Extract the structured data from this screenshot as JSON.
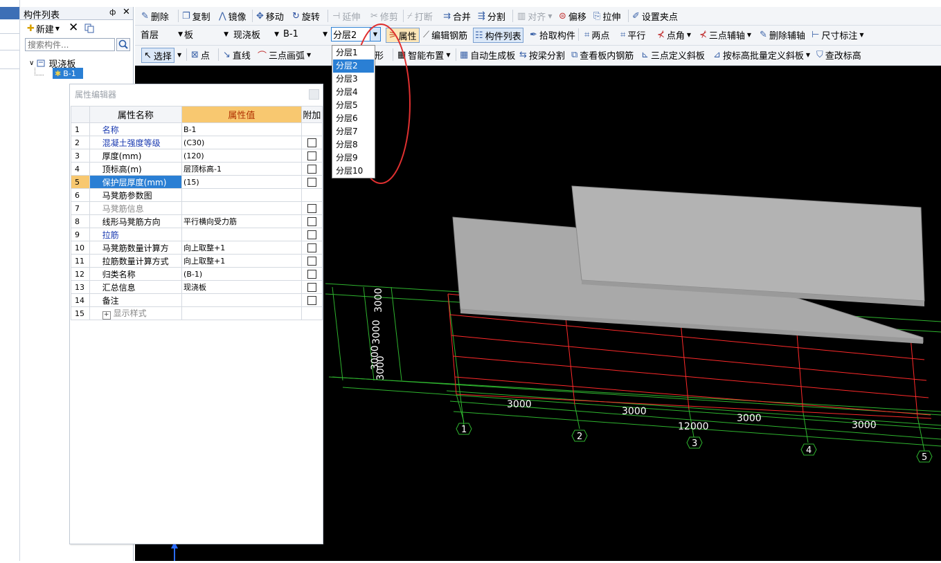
{
  "component_panel": {
    "title": "构件列表",
    "pin_label": "ф",
    "close_label": "✕",
    "new_label": "新建",
    "search_placeholder": "搜索构件...",
    "tree": {
      "root_label": "现浇板",
      "child_label": "B-1"
    }
  },
  "toolbar1": {
    "delete": "删除",
    "copy": "复制",
    "mirror": "镜像",
    "move": "移动",
    "rotate": "旋转",
    "extend": "延伸",
    "trim": "修剪",
    "break": "打断",
    "merge": "合并",
    "split": "分割",
    "align": "对齐",
    "offset": "偏移",
    "stretch": "拉伸",
    "set_grip": "设置夹点"
  },
  "toolbar2": {
    "floor": "首层",
    "category": "板",
    "type": "现浇板",
    "component": "B-1",
    "sublayer": "分层2",
    "properties": "属性",
    "edit_rebar": "编辑钢筋",
    "component_list": "构件列表",
    "pick_component": "拾取构件",
    "two_points": "两点",
    "parallel": "平行",
    "point_angle": "点角",
    "three_point_axis": "三点辅轴",
    "delete_axis": "删除辅轴",
    "dimension": "尺寸标注"
  },
  "toolbar3": {
    "select": "选择",
    "point": "点",
    "line": "直线",
    "three_point_arc": "三点画弧",
    "rect_partial": "矩形",
    "smart_place": "智能布置",
    "auto_slab": "自动生成板",
    "split_by_beam": "按梁分割",
    "view_rebar": "查看板内钢筋",
    "three_point_slope": "三点定义斜板",
    "batch_slope": "按标高批量定义斜板",
    "edit_elevation": "查改标高"
  },
  "sublayer_dropdown": {
    "options": [
      "分层1",
      "分层2",
      "分层3",
      "分层4",
      "分层5",
      "分层6",
      "分层7",
      "分层8",
      "分层9",
      "分层10"
    ],
    "selected_index": 1
  },
  "property_editor": {
    "title": "属性编辑器",
    "headers": {
      "name": "属性名称",
      "value": "属性值",
      "extra": "附加"
    },
    "rows": [
      {
        "num": "1",
        "name": "名称",
        "value": "B-1",
        "style": "blue",
        "check": false
      },
      {
        "num": "2",
        "name": "混凝土强度等级",
        "value": "(C30)",
        "style": "blue",
        "check": true
      },
      {
        "num": "3",
        "name": "厚度(mm)",
        "value": "(120)",
        "style": "",
        "check": true
      },
      {
        "num": "4",
        "name": "顶标高(m)",
        "value": "层顶标高-1",
        "style": "",
        "check": true
      },
      {
        "num": "5",
        "name": "保护层厚度(mm)",
        "value": "(15)",
        "style": "sel",
        "check": true
      },
      {
        "num": "6",
        "name": "马凳筋参数图",
        "value": "",
        "style": "",
        "check": false
      },
      {
        "num": "7",
        "name": "马凳筋信息",
        "value": "",
        "style": "gray",
        "check": true
      },
      {
        "num": "8",
        "name": "线形马凳筋方向",
        "value": "平行横向受力筋",
        "style": "",
        "check": true
      },
      {
        "num": "9",
        "name": "拉筋",
        "value": "",
        "style": "blue",
        "check": true
      },
      {
        "num": "10",
        "name": "马凳筋数量计算方",
        "value": "向上取整+1",
        "style": "",
        "check": true
      },
      {
        "num": "11",
        "name": "拉筋数量计算方式",
        "value": "向上取整+1",
        "style": "",
        "check": true
      },
      {
        "num": "12",
        "name": "归类名称",
        "value": "(B-1)",
        "style": "",
        "check": true
      },
      {
        "num": "13",
        "name": "汇总信息",
        "value": "现浇板",
        "style": "",
        "check": true
      },
      {
        "num": "14",
        "name": "备注",
        "value": "",
        "style": "",
        "check": true
      },
      {
        "num": "15",
        "name": "显示样式",
        "value": "",
        "style": "gray",
        "check": false
      }
    ]
  },
  "canvas": {
    "dim_span": "3000",
    "dim_total": "12000",
    "axis_labels": [
      "1",
      "2",
      "3",
      "4",
      "5"
    ],
    "vertical_dims": [
      "3000",
      "3000",
      "3000",
      "3000"
    ],
    "colors": {
      "background": "#000000",
      "grid_red": "#ff2a2a",
      "grid_green": "#2fb52f",
      "slab": "#a9a9a9"
    }
  }
}
